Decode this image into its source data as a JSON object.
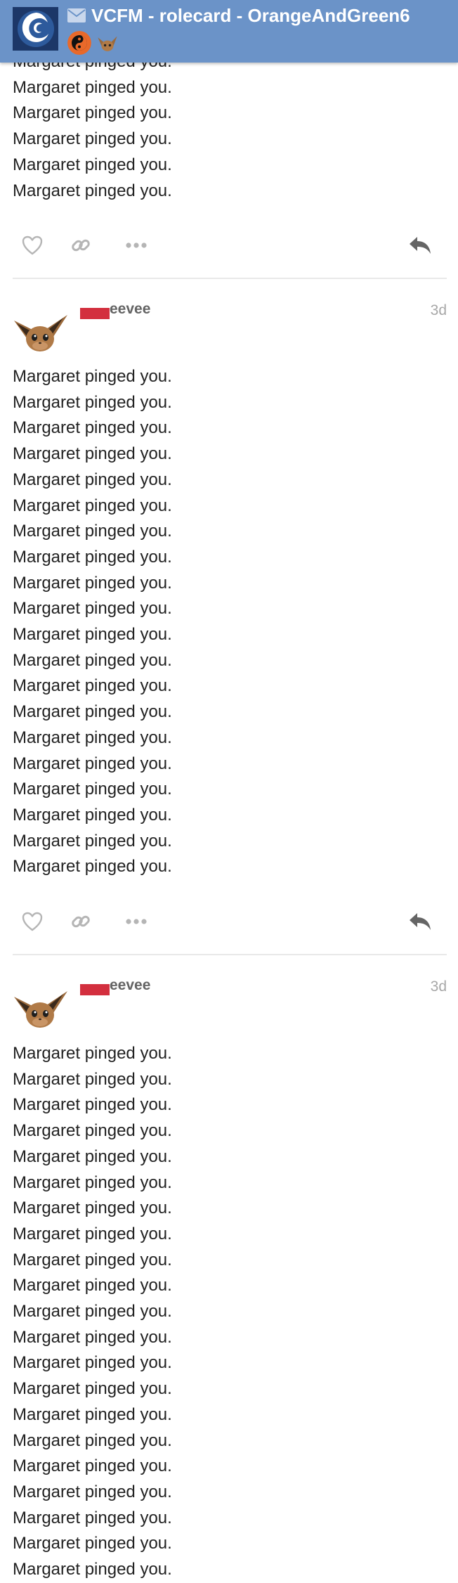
{
  "header": {
    "title": "VCFM - rolecard - OrangeAndGreen6",
    "participants": [
      "yin-yang-avatar",
      "eevee-avatar"
    ]
  },
  "colors": {
    "header_bg": "#6b93c8",
    "redaction": "#d32f3e",
    "username": "#646464",
    "date": "#a7a7a7",
    "divider": "#e9e9e9"
  },
  "message_line": "Margaret pinged you.",
  "posts": [
    {
      "username": "eevee",
      "date": "3d"
    },
    {
      "username": "eevee",
      "date": "3d"
    }
  ],
  "icons": [
    "heart-icon",
    "link-icon",
    "more-icon",
    "reply-icon"
  ]
}
